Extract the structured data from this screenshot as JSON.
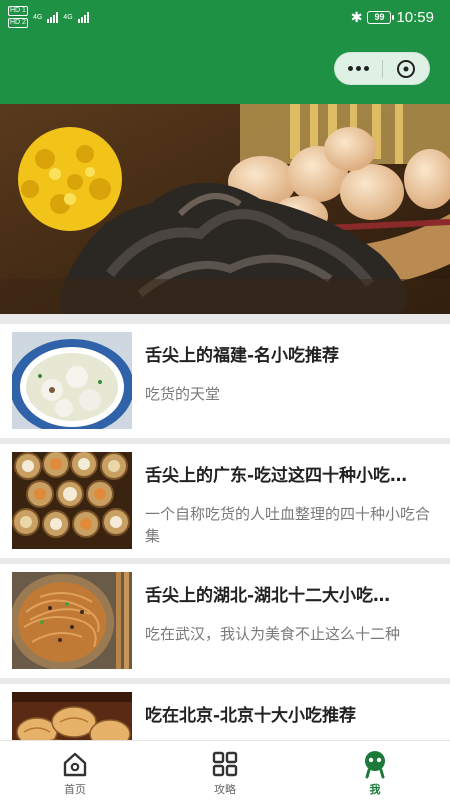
{
  "status_bar": {
    "sim1": "HD 1",
    "sim2": "HD 2",
    "network": "4G",
    "battery": "99",
    "time": "10:59"
  },
  "capsule": {
    "more_icon": "more-dots-icon",
    "close_icon": "close-circle-icon"
  },
  "articles": [
    {
      "title": "舌尖上的福建-名小吃推荐",
      "desc": "吃货的天堂"
    },
    {
      "title": "舌尖上的广东-吃过这四十种小吃…",
      "desc": "一个自称吃货的人吐血整理的四十种小吃合集"
    },
    {
      "title": "舌尖上的湖北-湖北十二大小吃…",
      "desc": "吃在武汉，我认为美食不止这么十二种"
    },
    {
      "title": "吃在北京-北京十大小吃推荐",
      "desc": ""
    }
  ],
  "tabbar": {
    "items": [
      {
        "label": "首页",
        "icon": "home-icon"
      },
      {
        "label": "攻略",
        "icon": "grid-icon"
      },
      {
        "label": "我",
        "icon": "profile-icon"
      }
    ],
    "active": "我"
  },
  "colors": {
    "brand_green": "#1e9145",
    "active_tab": "#1e7a3a"
  }
}
